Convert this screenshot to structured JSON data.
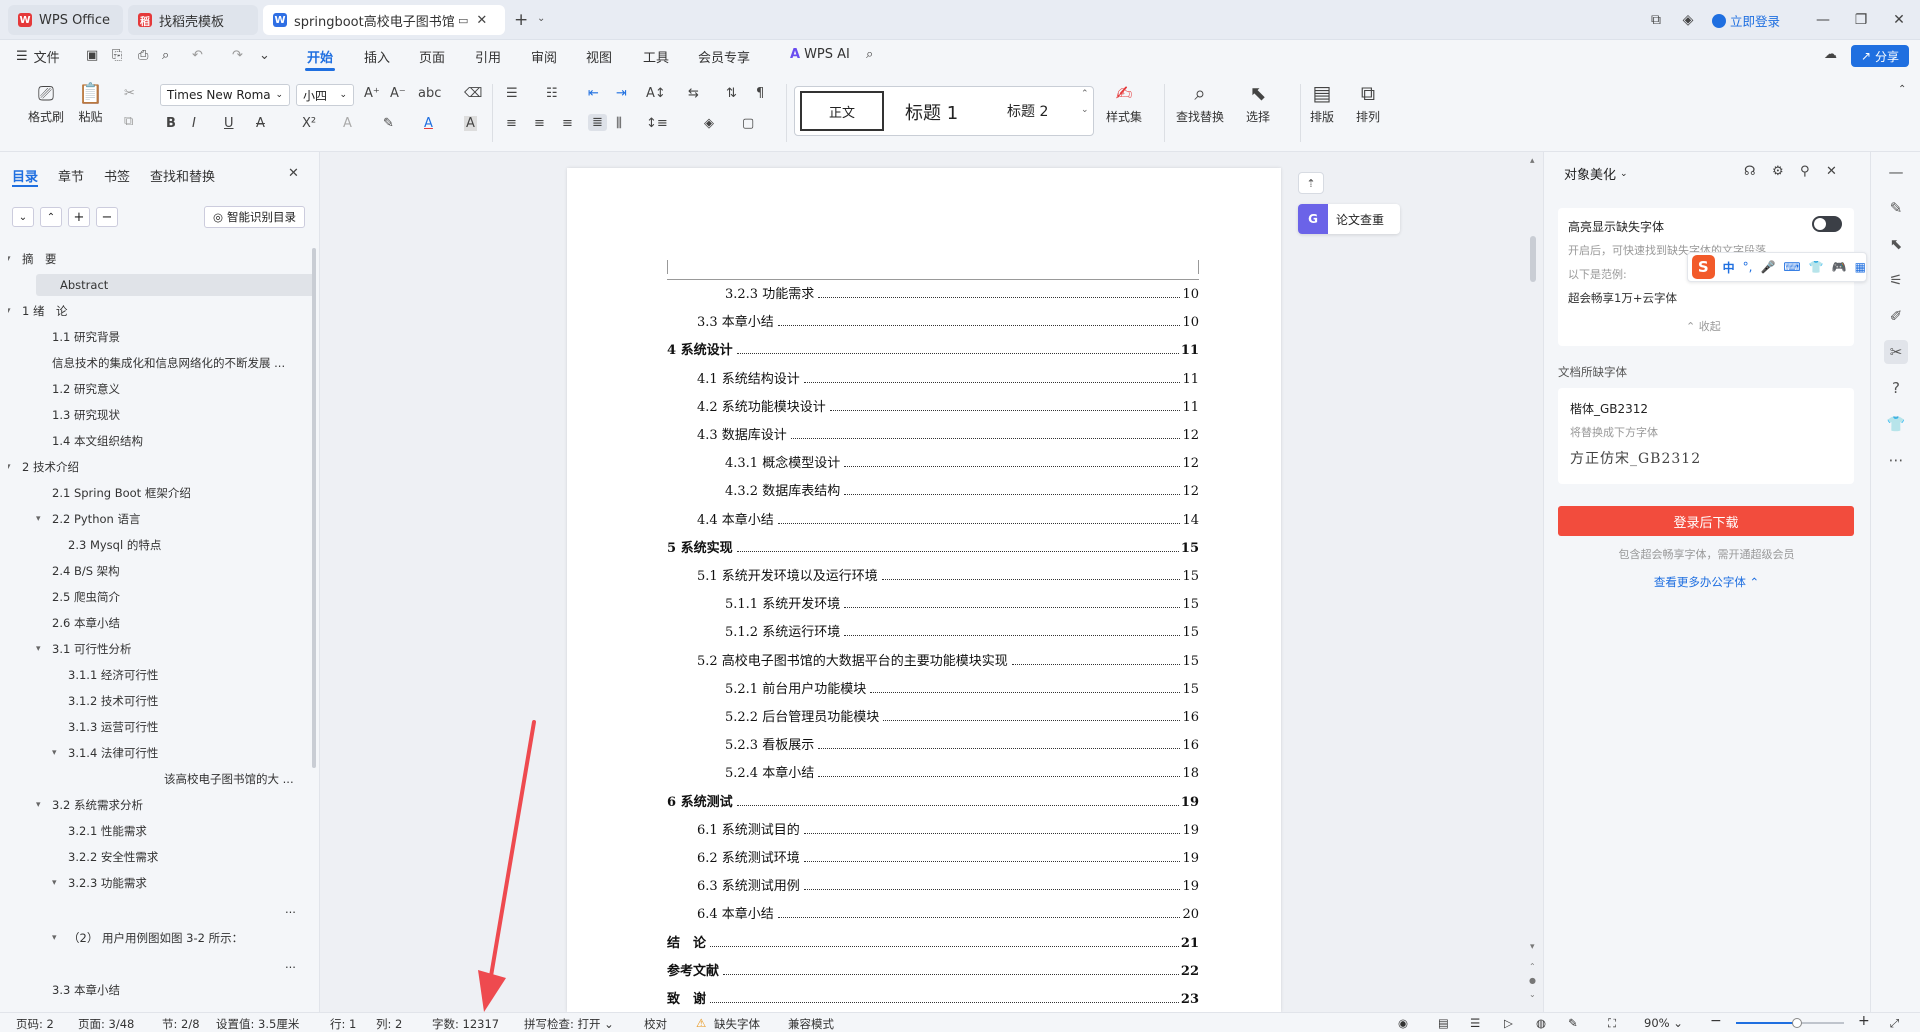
{
  "tabs": [
    {
      "label": "WPS Office",
      "icon": "wps-logo-icon"
    },
    {
      "label": "找稻壳模板",
      "icon": "docer-icon"
    },
    {
      "label": "springboot高校电子图书馆的",
      "icon": "word-doc-icon"
    }
  ],
  "titlebar": {
    "login": "立即登录"
  },
  "menu": {
    "file": "文件",
    "items": [
      "开始",
      "插入",
      "页面",
      "引用",
      "审阅",
      "视图",
      "工具",
      "会员专享"
    ],
    "active": "开始",
    "wps_ai": "WPS AI",
    "share": "分享"
  },
  "ribbon": {
    "format_brush": "格式刷",
    "paste": "粘贴",
    "font_name": "Times New Roma",
    "font_size": "小四",
    "styles": [
      "正文",
      "标题 1",
      "标题 2"
    ],
    "style_set": "样式集",
    "find_replace": "查找替换",
    "select": "选择",
    "layout": "排版",
    "arrange": "排列"
  },
  "left_panel": {
    "tabs": [
      "目录",
      "章节",
      "书签",
      "查找和替换"
    ],
    "active_tab": "目录",
    "smart_toc": "智能识别目录",
    "toc": [
      {
        "text": "摘　要",
        "level": 1,
        "caret": "▾"
      },
      {
        "text": "Abstract",
        "level": 2,
        "selected": true
      },
      {
        "text": "1  绪　论",
        "level": 1,
        "caret": "▾"
      },
      {
        "text": "1.1 研究背景",
        "level": 2
      },
      {
        "text": "信息技术的集成化和信息网络化的不断发展 ...",
        "level": 2
      },
      {
        "text": "1.2  研究意义",
        "level": 2
      },
      {
        "text": "1.3 研究现状",
        "level": 2
      },
      {
        "text": "1.4 本文组织结构",
        "level": 2
      },
      {
        "text": "2  技术介绍",
        "level": 1,
        "caret": "▾"
      },
      {
        "text": "2.1 Spring Boot 框架介绍",
        "level": 2
      },
      {
        "text": "2.2 Python 语言",
        "level": 2,
        "caret": "▾"
      },
      {
        "text": "2.3 Mysql 的特点",
        "level": 3
      },
      {
        "text": "2.4 B/S 架构",
        "level": 2
      },
      {
        "text": "2.5  爬虫简介",
        "level": 2
      },
      {
        "text": "2.6 本章小结",
        "level": 2
      },
      {
        "text": "3.1 可行性分析",
        "level": 2,
        "caret": "▾"
      },
      {
        "text": "3.1.1 经济可行性",
        "level": 3
      },
      {
        "text": "3.1.2 技术可行性",
        "level": 3
      },
      {
        "text": "3.1.3 运营可行性",
        "level": 3
      },
      {
        "text": "3.1.4 法律可行性",
        "level": 3,
        "caret": "▾"
      },
      {
        "text": "该高校电子图书馆的大 ...",
        "level": 5
      },
      {
        "text": "3.2 系统需求分析",
        "level": 2,
        "caret": "▾"
      },
      {
        "text": "3.2.1  性能需求",
        "level": 3
      },
      {
        "text": "3.2.2  安全性需求",
        "level": 3
      },
      {
        "text": "3.2.3 功能需求",
        "level": 3,
        "caret": "▾"
      },
      {
        "text": "...",
        "level": 6
      },
      {
        "text": "（2）  用户用例图如图 3-2 所示：",
        "level": 3,
        "caret": "▾"
      },
      {
        "text": "...",
        "level": 6
      },
      {
        "text": "3.3 本章小结",
        "level": 2
      }
    ]
  },
  "doc_toc": [
    {
      "label": "3.2.3  功能需求",
      "page": "10",
      "indent": 2,
      "bold": false
    },
    {
      "label": "3.3 本章小结",
      "page": "10",
      "indent": 1,
      "bold": false
    },
    {
      "label": "4 系统设计",
      "page": "11",
      "indent": 0,
      "bold": true
    },
    {
      "label": "4.1 系统结构设计",
      "page": "11",
      "indent": 1,
      "bold": false
    },
    {
      "label": "4.2 系统功能模块设计",
      "page": "11",
      "indent": 1,
      "bold": false
    },
    {
      "label": "4.3  数据库设计",
      "page": "12",
      "indent": 1,
      "bold": false
    },
    {
      "label": "4.3.1  概念模型设计",
      "page": "12",
      "indent": 2,
      "bold": false
    },
    {
      "label": "4.3.2  数据库表结构",
      "page": "12",
      "indent": 2,
      "bold": false
    },
    {
      "label": "4.4 本章小结",
      "page": "14",
      "indent": 1,
      "bold": false
    },
    {
      "label": "5  系统实现",
      "page": "15",
      "indent": 0,
      "bold": true
    },
    {
      "label": "5.1 系统开发环境以及运行环境",
      "page": "15",
      "indent": 1,
      "bold": false
    },
    {
      "label": "5.1.1  系统开发环境",
      "page": "15",
      "indent": 2,
      "bold": false
    },
    {
      "label": "5.1.2  系统运行环境",
      "page": "15",
      "indent": 2,
      "bold": false
    },
    {
      "label": "5.2 高校电子图书馆的大数据平台的主要功能模块实现",
      "page": "15",
      "indent": 1,
      "bold": false
    },
    {
      "label": "5.2.1 前台用户功能模块",
      "page": "15",
      "indent": 2,
      "bold": false
    },
    {
      "label": "5.2.2 后台管理员功能模块",
      "page": "16",
      "indent": 2,
      "bold": false
    },
    {
      "label": "5.2.3 看板展示",
      "page": "16",
      "indent": 2,
      "bold": false
    },
    {
      "label": "5.2.4 本章小结",
      "page": "18",
      "indent": 2,
      "bold": false
    },
    {
      "label": "6 系统测试",
      "page": "19",
      "indent": 0,
      "bold": true
    },
    {
      "label": "6.1  系统测试目的",
      "page": "19",
      "indent": 1,
      "bold": false
    },
    {
      "label": "6.2  系统测试环境",
      "page": "19",
      "indent": 1,
      "bold": false
    },
    {
      "label": "6.3 系统测试用例",
      "page": "19",
      "indent": 1,
      "bold": false
    },
    {
      "label": "6.4 本章小结",
      "page": "20",
      "indent": 1,
      "bold": false
    },
    {
      "label": "结　论",
      "page": "21",
      "indent": 0,
      "bold": true
    },
    {
      "label": "参考文献",
      "page": "22",
      "indent": 0,
      "bold": true
    },
    {
      "label": "致　谢",
      "page": "23",
      "indent": 0,
      "bold": true
    }
  ],
  "float": {
    "plagiarism": "论文查重"
  },
  "right_panel": {
    "title": "对象美化",
    "highlight_missing": "高亮显示缺失字体",
    "desc": "开启后，可快速找到缺失字体的文字段落",
    "example_label": "以下是范例:",
    "example_text": "超会畅享1万+云字体",
    "collapse": "收起",
    "missing_title": "文档所缺字体",
    "missing_font": "楷体_GB2312",
    "replaced_label": "将替换成下方字体",
    "replacement_font": "方正仿宋_GB2312",
    "download_btn": "登录后下载",
    "download_note": "包含超会畅享字体，需开通超级会员",
    "more_fonts": "查看更多办公字体",
    "ime_zh": "中"
  },
  "status": {
    "page_no": "页码: 2",
    "pages": "页面: 3/48",
    "section": "节: 2/8",
    "setting": "设置值: 3.5厘米",
    "row": "行: 1",
    "col": "列: 2",
    "words": "字数: 12317",
    "spell": "拼写检查: 打开",
    "proof": "校对",
    "missing_font": "缺失字体",
    "compat": "兼容模式",
    "zoom": "90%"
  },
  "colors": {
    "accent": "#1f6fe0",
    "download": "#f24c3d",
    "wps_red": "#e5393a",
    "arrow": "#ee4a4f"
  }
}
